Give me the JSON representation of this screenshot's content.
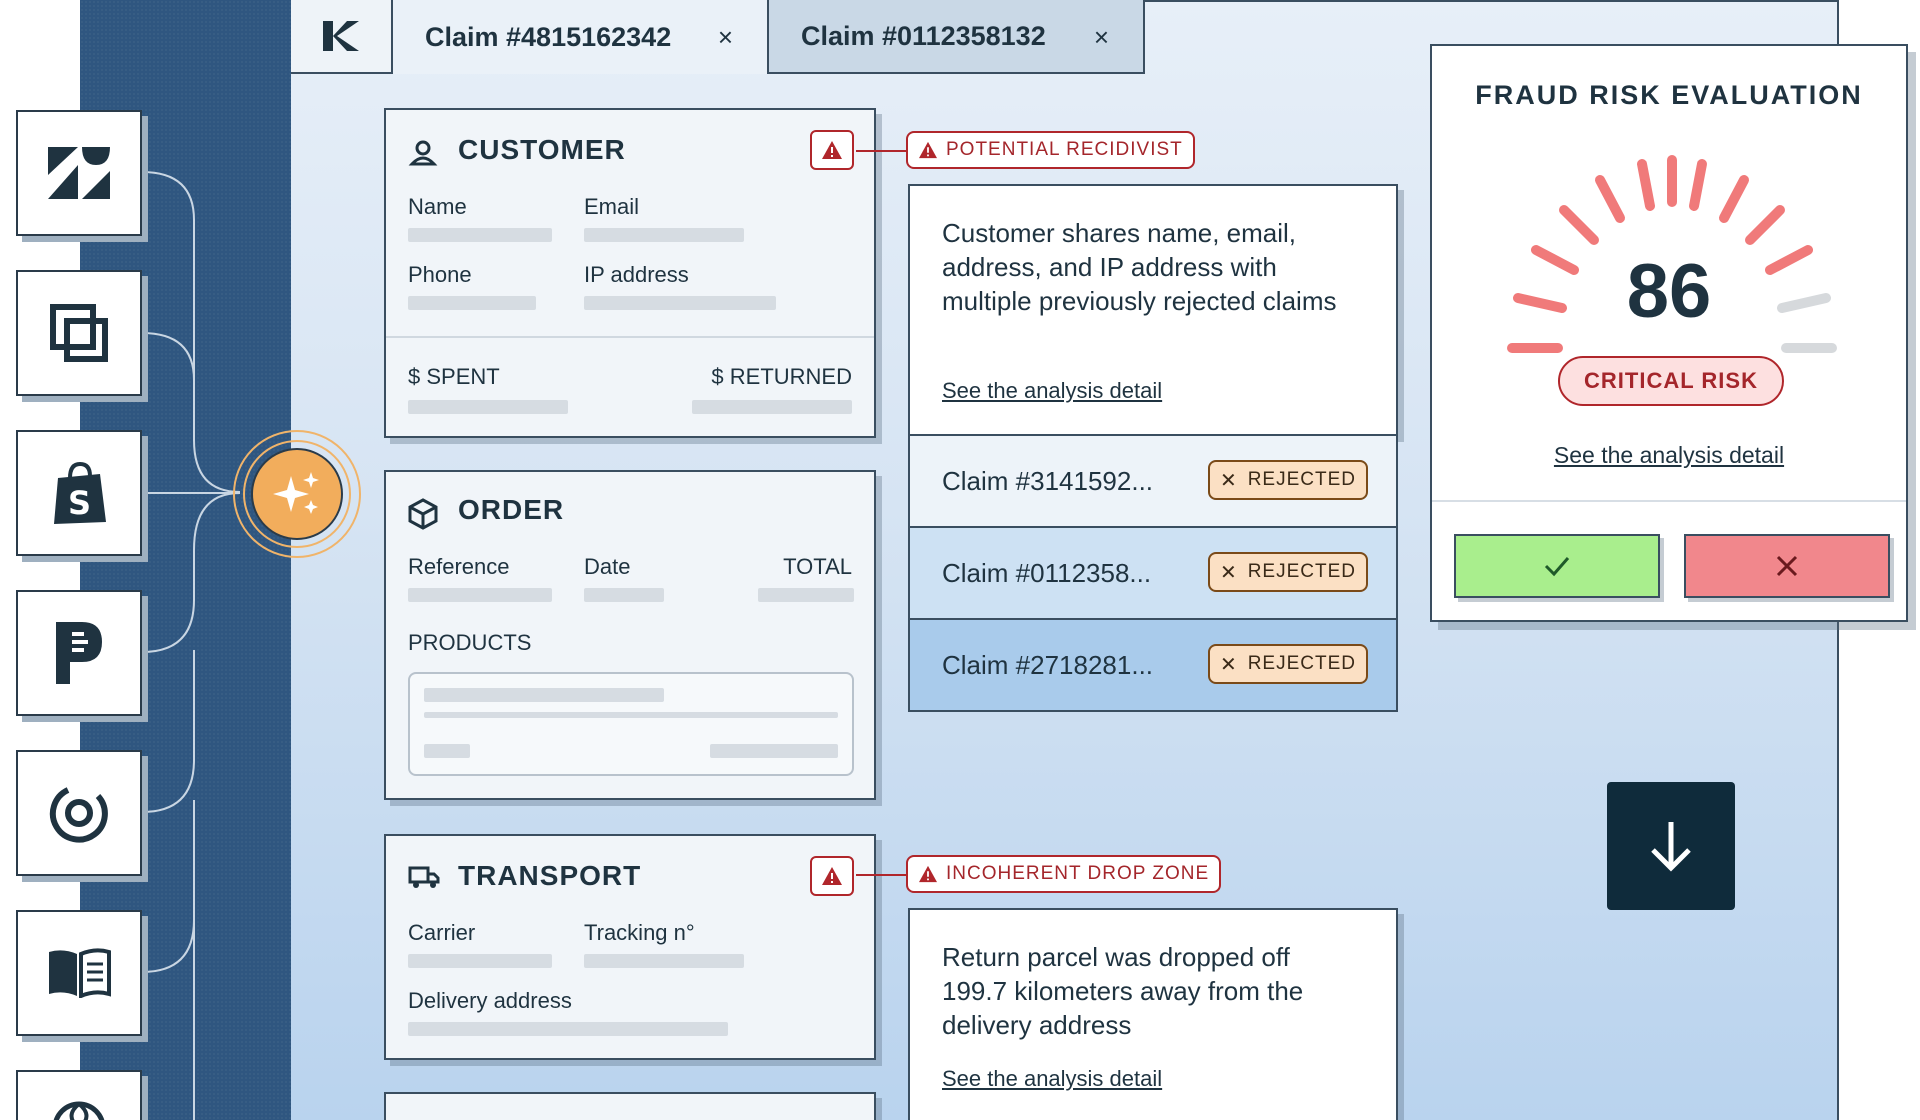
{
  "tabs": [
    {
      "label": "Claim #4815162342",
      "close": "×"
    },
    {
      "label": "Claim #0112358132",
      "close": "×"
    }
  ],
  "customer": {
    "title": "CUSTOMER",
    "name_label": "Name",
    "email_label": "Email",
    "phone_label": "Phone",
    "ip_label": "IP address",
    "spent_label": "$ SPENT",
    "returned_label": "$ RETURNED"
  },
  "order": {
    "title": "ORDER",
    "reference_label": "Reference",
    "date_label": "Date",
    "total_label": "TOTAL",
    "products_label": "PRODUCTS"
  },
  "transport": {
    "title": "TRANSPORT",
    "carrier_label": "Carrier",
    "tracking_label": "Tracking n°",
    "delivery_label": "Delivery address"
  },
  "flags": {
    "recidivist": "POTENTIAL RECIDIVIST",
    "drop_zone": "INCOHERENT DROP ZONE"
  },
  "recidivist_panel": {
    "text": "Customer shares name, email, address, and IP address with multiple previously rejected claims",
    "link": "See the analysis detail"
  },
  "claims": [
    {
      "label": "Claim #3141592...",
      "status": "REJECTED"
    },
    {
      "label": "Claim #0112358...",
      "status": "REJECTED"
    },
    {
      "label": "Claim #2718281...",
      "status": "REJECTED"
    }
  ],
  "drop_panel": {
    "text": "Return parcel was dropped off 199.7 kilometers away from the delivery address",
    "link": "See the analysis detail"
  },
  "fraud": {
    "title": "FRAUD RISK EVALUATION",
    "score": "86",
    "risk": "CRITICAL RISK",
    "link": "See the analysis detail"
  },
  "colors": {
    "accent_orange": "#f2ad5c",
    "danger": "#b0262b",
    "approve": "#a9ee8d",
    "deny": "#f1878c",
    "navy": "#0f2b3b"
  },
  "icons": [
    "zendesk-icon",
    "copy-icon",
    "shopify-icon",
    "parcel-icon",
    "cycle-icon",
    "book-icon",
    "globe-icon"
  ]
}
